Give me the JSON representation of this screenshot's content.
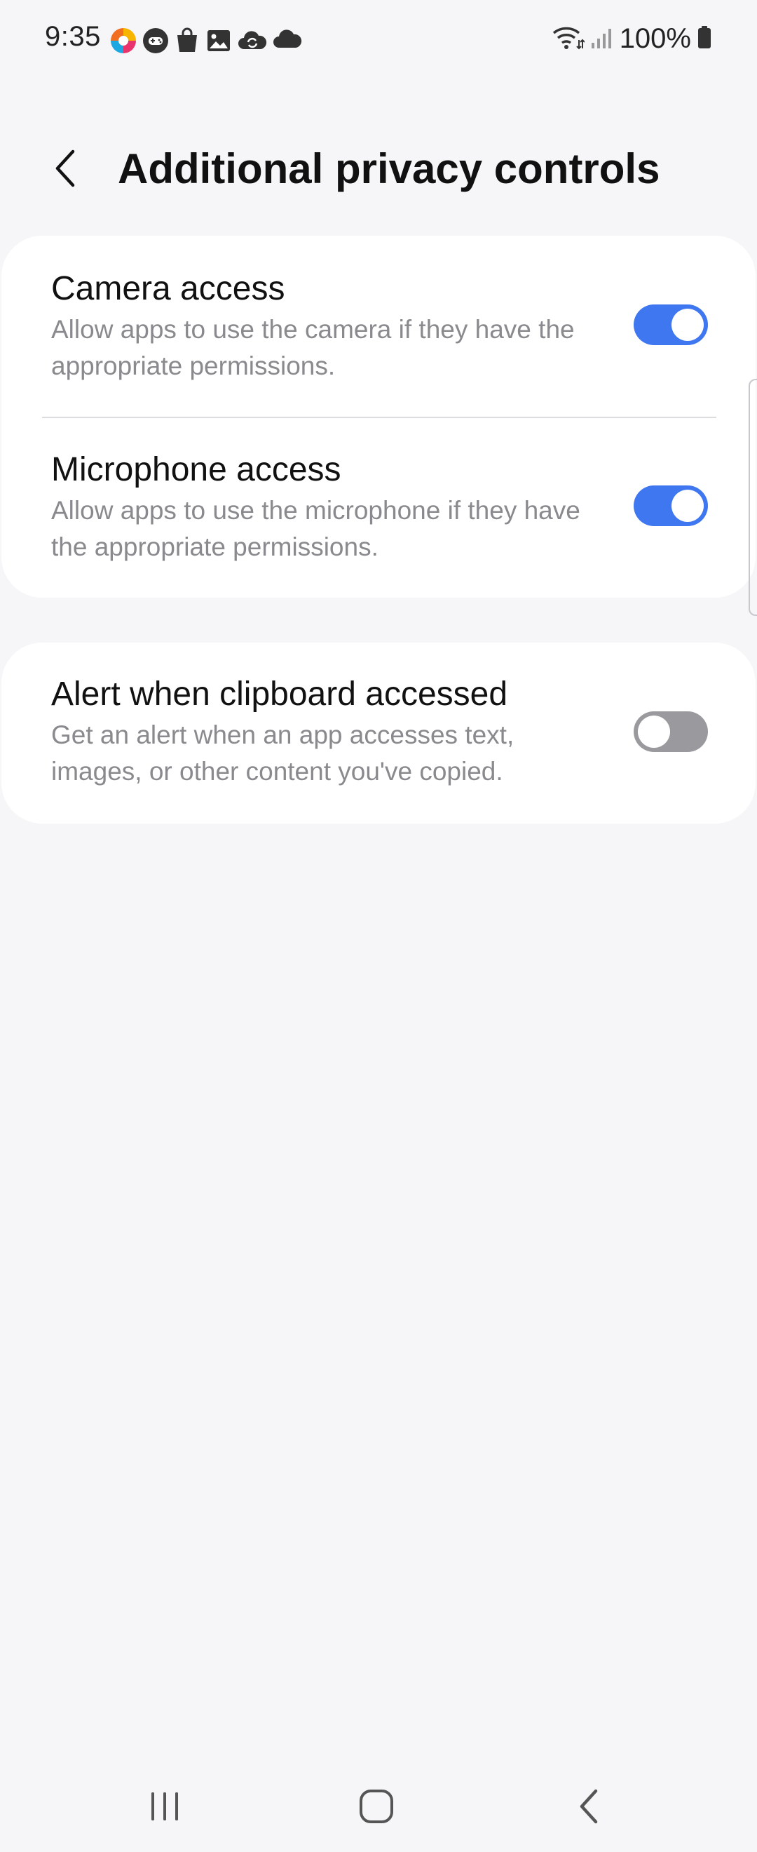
{
  "status_bar": {
    "time": "9:35",
    "notification_icons": [
      "multicolor-app-icon",
      "game-controller-icon",
      "shopping-bag-icon",
      "gallery-icon",
      "cloud-sync-icon",
      "cloud-icon"
    ],
    "battery_text": "100%",
    "system_icons": [
      "wifi-icon",
      "signal-icon",
      "battery-icon"
    ]
  },
  "header": {
    "title": "Additional privacy controls",
    "back_icon": "chevron-left-icon"
  },
  "settings": {
    "camera": {
      "title": "Camera access",
      "description": "Allow apps to use the camera if they have the appropriate permissions.",
      "enabled": true
    },
    "microphone": {
      "title": "Microphone access",
      "description": "Allow apps to use the microphone if they have the appropriate permissions.",
      "enabled": true
    },
    "clipboard": {
      "title": "Alert when clipboard accessed",
      "description": "Get an alert when an app accesses text, images, or other content you've copied.",
      "enabled": false
    }
  },
  "colors": {
    "toggle_on": "#3e77f0",
    "toggle_off": "#9a9a9e",
    "background": "#f6f6f8",
    "card": "#ffffff"
  },
  "nav_bar": {
    "buttons": [
      "recents-icon",
      "home-icon",
      "back-icon"
    ]
  }
}
